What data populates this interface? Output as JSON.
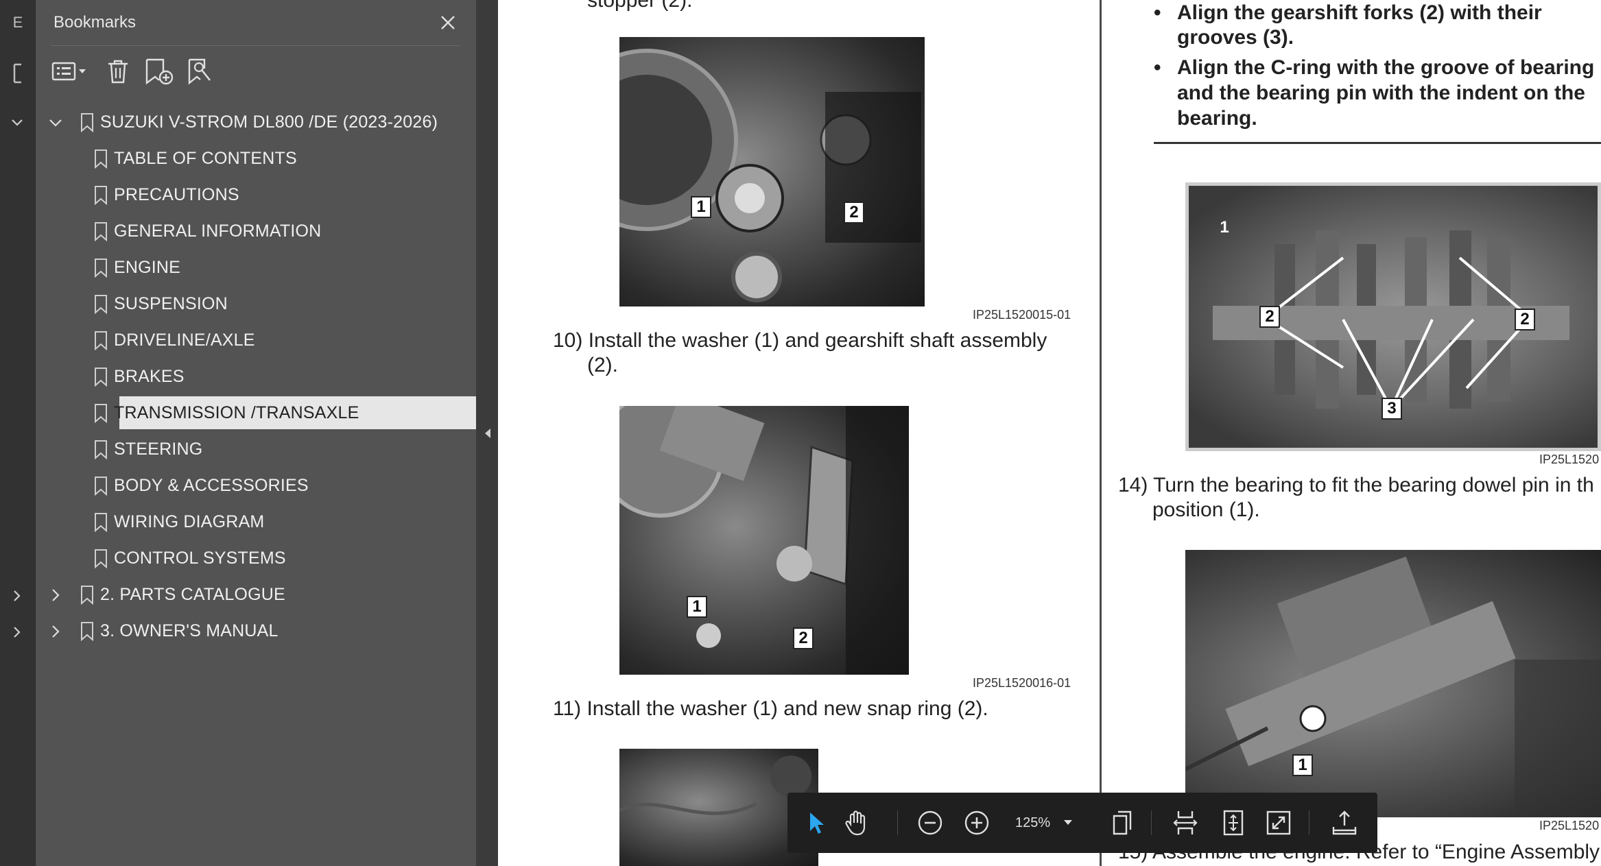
{
  "rail": {
    "top_tab_label": "E",
    "chevron_rows": [
      "down",
      "right",
      "right"
    ]
  },
  "panel": {
    "title": "Bookmarks",
    "toolbar": {
      "options_icon": "list-options-icon",
      "delete_icon": "trash-icon",
      "new_bookmark_icon": "add-bookmark-icon",
      "find_bookmark_icon": "find-bookmark-icon"
    }
  },
  "bookmarks": [
    {
      "label": "SUZUKI V-STROM DL800 /DE (2023-2026)",
      "level": 0,
      "expander": "down"
    },
    {
      "label": "TABLE OF CONTENTS",
      "level": 1
    },
    {
      "label": "PRECAUTIONS",
      "level": 1
    },
    {
      "label": "GENERAL INFORMATION",
      "level": 1
    },
    {
      "label": "ENGINE",
      "level": 1
    },
    {
      "label": "SUSPENSION",
      "level": 1
    },
    {
      "label": "DRIVELINE/AXLE",
      "level": 1
    },
    {
      "label": "BRAKES",
      "level": 1
    },
    {
      "label": "TRANSMISSION /TRANSAXLE",
      "level": 1,
      "selected": true
    },
    {
      "label": "STEERING",
      "level": 1
    },
    {
      "label": "BODY & ACCESSORIES",
      "level": 1
    },
    {
      "label": "WIRING DIAGRAM",
      "level": 1
    },
    {
      "label": "CONTROL SYSTEMS",
      "level": 1
    },
    {
      "label": "2. PARTS CATALOGUE",
      "level": 0,
      "expander": "right"
    },
    {
      "label": "3. OWNER'S MANUAL",
      "level": 0,
      "expander": "right"
    }
  ],
  "document": {
    "top_text": "stopper (2).",
    "step10": "10) Install the washer (1) and gearshift shaft assembly",
    "step10b": "(2).",
    "step11": "11) Install the washer (1) and new snap ring (2).",
    "img1_id": "IP25L1520015-01",
    "img2_id": "IP25L1520016-01",
    "img3_id": "IP25L1520",
    "img4_id": "IP25L1520",
    "bullet1a": "Align the gearshift forks (2) with their",
    "bullet1b": "grooves (3).",
    "bullet2a": "Align the C-ring with the groove of bearing",
    "bullet2b": "and the bearing pin with the indent on the",
    "bullet2c": "bearing.",
    "step14a": "14) Turn the bearing to fit the bearing dowel pin in th",
    "step14b": "position (1).",
    "step15": "15) Assemble the engine. Refer to “Engine Assembly",
    "callouts": {
      "one": "1",
      "two": "2",
      "three": "3"
    }
  },
  "float_toolbar": {
    "zoom_value": "125%",
    "icons": [
      "select-arrow-icon",
      "hand-tool-icon",
      "zoom-out-icon",
      "zoom-in-icon",
      "page-display-icon",
      "fit-width-icon",
      "fit-page-icon",
      "full-screen-icon",
      "share-icon"
    ],
    "accent": "#2ca7f0"
  },
  "colors": {
    "panel_bg": "#535353",
    "selected_bg": "#e6e6e6",
    "toolbar_bg": "#1f1f1f"
  }
}
